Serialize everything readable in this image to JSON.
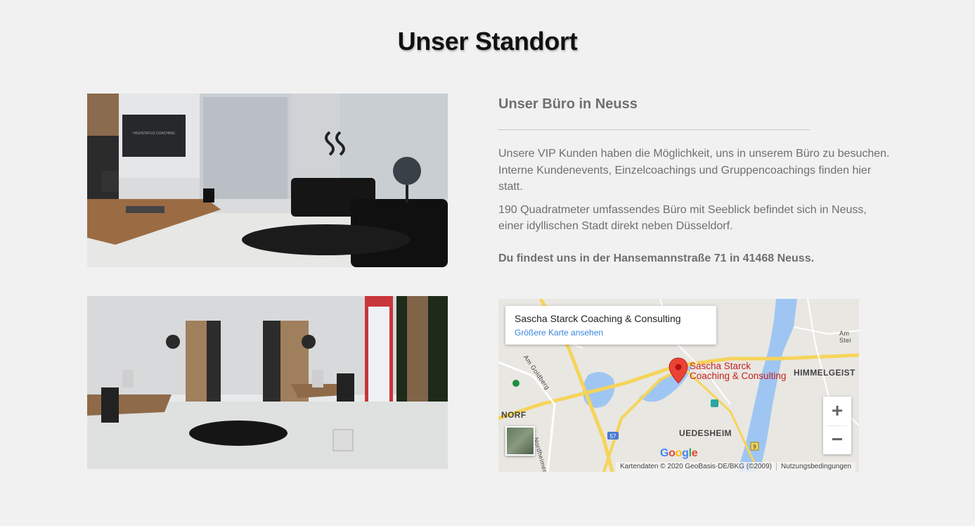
{
  "heading": {
    "light": "Unser ",
    "bold": "Standort"
  },
  "info": {
    "title": "Unser Büro in Neuss",
    "paragraph1": "Unsere VIP Kunden haben die Möglichkeit, uns in unserem Büro zu besuchen. Interne Kundenevents, Einzelcoachings und Gruppencoachings finden hier statt.",
    "paragraph2": "190 Quadratmeter umfassendes Büro mit Seeblick befindet sich in Neuss, einer idyllischen Stadt direkt neben Düsseldorf.",
    "address": "Du findest uns in der Hansemannstraße 71 in 41468 Neuss."
  },
  "map": {
    "place_name": "Sascha Starck Coaching & Consulting",
    "larger_map_link": "Größere Karte ansehen",
    "marker_label_line1": "Sascha Starck",
    "marker_label_line2": "Coaching & Consulting",
    "labels": {
      "himmelgeist": "HIMMELGEIST",
      "norf": "NORF",
      "uedesheim": "UEDESHEIM",
      "am_goldberg": "Am Goldberg",
      "am_steinebrück": "Am Stei",
      "street_bottom": "Nordheimer Str",
      "highway": "57",
      "road9": "9"
    },
    "zoom_in": "+",
    "zoom_out": "−",
    "logo": "Google",
    "attribution": "Kartendaten © 2020 GeoBasis-DE/BKG (©2009)",
    "terms": "Nutzungsbedingungen",
    "colors": {
      "water": "#9fc6f2",
      "highway": "#f6d45a",
      "marker": "#ea4335"
    }
  }
}
